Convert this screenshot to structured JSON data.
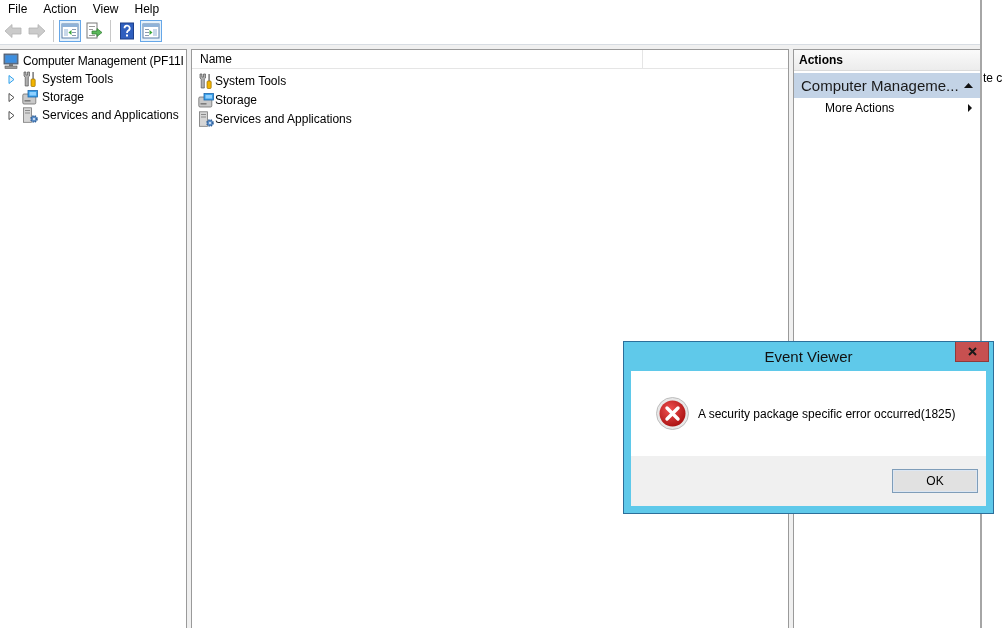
{
  "menu_bar": [
    "File",
    "Action",
    "View",
    "Help"
  ],
  "toolbar": [
    [
      {
        "kind": "back",
        "disabled": true,
        "pressed": false
      },
      {
        "kind": "forward",
        "disabled": true,
        "pressed": false
      }
    ],
    [
      {
        "kind": "tree",
        "disabled": false,
        "pressed": true
      },
      {
        "kind": "export",
        "disabled": false,
        "pressed": false
      }
    ],
    [
      {
        "kind": "help",
        "disabled": false,
        "pressed": false
      },
      {
        "kind": "actions",
        "disabled": false,
        "pressed": true
      }
    ]
  ],
  "tree": {
    "label": "Computer Management (PF11I",
    "kind": "computer",
    "children": [
      {
        "label": "System Tools",
        "kind": "tools",
        "expanded": false,
        "hover": true
      },
      {
        "label": "Storage",
        "kind": "storage",
        "expanded": false,
        "hover": false
      },
      {
        "label": "Services and Applications",
        "kind": "services",
        "expanded": false,
        "hover": false
      }
    ]
  },
  "list": {
    "columns": [
      "Name"
    ],
    "rows": [
      {
        "name": "System Tools",
        "kind": "tools"
      },
      {
        "name": "Storage",
        "kind": "storage"
      },
      {
        "name": "Services and Applications",
        "kind": "services"
      }
    ]
  },
  "actions": {
    "title": "Actions",
    "sections": [
      {
        "title": "Computer Manageme...",
        "expanded": true,
        "items": [
          {
            "label": "More Actions",
            "has_submenu": true
          }
        ]
      }
    ]
  },
  "background_window": {
    "text": "te c"
  },
  "dialog": {
    "title": "Event Viewer",
    "message": "A security package specific error occurred(1825)",
    "buttons": [
      {
        "label": "OK",
        "default": true
      }
    ]
  }
}
